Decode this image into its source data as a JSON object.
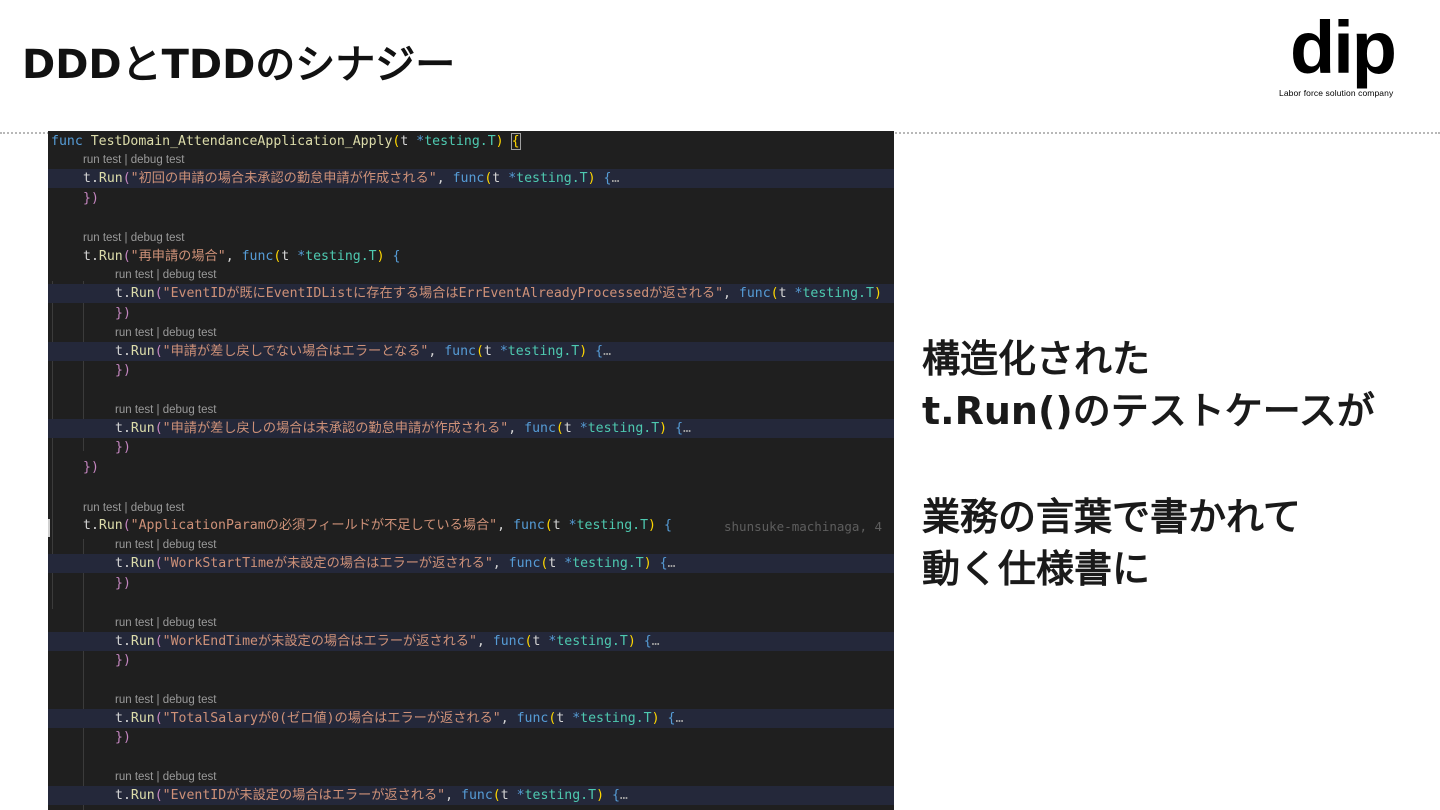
{
  "slide": {
    "title": "DDDとTDDのシナジー"
  },
  "logo": {
    "wordmark": "dip",
    "tagline": "Labor force solution company"
  },
  "code_lens": "run test | debug test",
  "code": {
    "l1": {
      "kw": "func ",
      "fn": "TestDomain_AttendanceApplication_Apply",
      "p1": "(",
      "t": "t ",
      "star": "*",
      "typ": "testing.T",
      "p2": ") ",
      "br": "{"
    },
    "l2": {
      "a": "t.",
      "fn": "Run",
      "p1": "(",
      "str": "\"初回の申請の場合未承認の勤怠申請が作成される\"",
      "c": ", ",
      "kw": "func",
      "p2": "(",
      "t": "t ",
      "star": "*",
      "typ": "testing.T",
      "p3": ") ",
      "br": "{",
      "fold": "…"
    },
    "l3": {
      "br": "}",
      "p": ")"
    },
    "l4": {
      "a": "t.",
      "fn": "Run",
      "p1": "(",
      "str": "\"再申請の場合\"",
      "c": ", ",
      "kw": "func",
      "p2": "(",
      "t": "t ",
      "star": "*",
      "typ": "testing.T",
      "p3": ") ",
      "br": "{"
    },
    "l5": {
      "a": "t.",
      "fn": "Run",
      "p1": "(",
      "str": "\"EventIDが既にEventIDListに存在する場合はErrEventAlreadyProcessedが返される\"",
      "c": ", ",
      "kw": "func",
      "p2": "(",
      "t": "t ",
      "star": "*",
      "typ": "testing.T",
      "p3": ")"
    },
    "l6": {
      "br": "}",
      "p": ")"
    },
    "l7": {
      "a": "t.",
      "fn": "Run",
      "p1": "(",
      "str": "\"申請が差し戻しでない場合はエラーとなる\"",
      "c": ", ",
      "kw": "func",
      "p2": "(",
      "t": "t ",
      "star": "*",
      "typ": "testing.T",
      "p3": ") ",
      "br": "{",
      "fold": "…"
    },
    "l8": {
      "br": "}",
      "p": ")"
    },
    "l9": {
      "a": "t.",
      "fn": "Run",
      "p1": "(",
      "str": "\"申請が差し戻しの場合は未承認の勤怠申請が作成される\"",
      "c": ", ",
      "kw": "func",
      "p2": "(",
      "t": "t ",
      "star": "*",
      "typ": "testing.T",
      "p3": ") ",
      "br": "{",
      "fold": "…"
    },
    "l10": {
      "br": "}",
      "p": ")"
    },
    "l11": {
      "br": "}",
      "p": ")"
    },
    "l12": {
      "a": "t.",
      "fn": "Run",
      "p1": "(",
      "str": "\"ApplicationParamの必須フィールドが不足している場合\"",
      "c": ", ",
      "kw": "func",
      "p2": "(",
      "t": "t ",
      "star": "*",
      "typ": "testing.T",
      "p3": ") ",
      "br": "{",
      "blame": "shunsuke-machinaga, 4"
    },
    "l13": {
      "a": "t.",
      "fn": "Run",
      "p1": "(",
      "str": "\"WorkStartTimeが未設定の場合はエラーが返される\"",
      "c": ", ",
      "kw": "func",
      "p2": "(",
      "t": "t ",
      "star": "*",
      "typ": "testing.T",
      "p3": ") ",
      "br": "{",
      "fold": "…"
    },
    "l14": {
      "br": "}",
      "p": ")"
    },
    "l15": {
      "a": "t.",
      "fn": "Run",
      "p1": "(",
      "str": "\"WorkEndTimeが未設定の場合はエラーが返される\"",
      "c": ", ",
      "kw": "func",
      "p2": "(",
      "t": "t ",
      "star": "*",
      "typ": "testing.T",
      "p3": ") ",
      "br": "{",
      "fold": "…"
    },
    "l16": {
      "br": "}",
      "p": ")"
    },
    "l17": {
      "a": "t.",
      "fn": "Run",
      "p1": "(",
      "str": "\"TotalSalaryが0(ゼロ値)の場合はエラーが返される\"",
      "c": ", ",
      "kw": "func",
      "p2": "(",
      "t": "t ",
      "star": "*",
      "typ": "testing.T",
      "p3": ") ",
      "br": "{",
      "fold": "…"
    },
    "l18": {
      "br": "}",
      "p": ")"
    },
    "l19": {
      "a": "t.",
      "fn": "Run",
      "p1": "(",
      "str": "\"EventIDが未設定の場合はエラーが返される\"",
      "c": ", ",
      "kw": "func",
      "p2": "(",
      "t": "t ",
      "star": "*",
      "typ": "testing.T",
      "p3": ") ",
      "br": "{",
      "fold": "…"
    }
  },
  "caption": {
    "line1": "構造化された",
    "line2": "t.Run()のテストケースが",
    "line3": "業務の言葉で書かれて",
    "line4": "動く仕様書に"
  }
}
